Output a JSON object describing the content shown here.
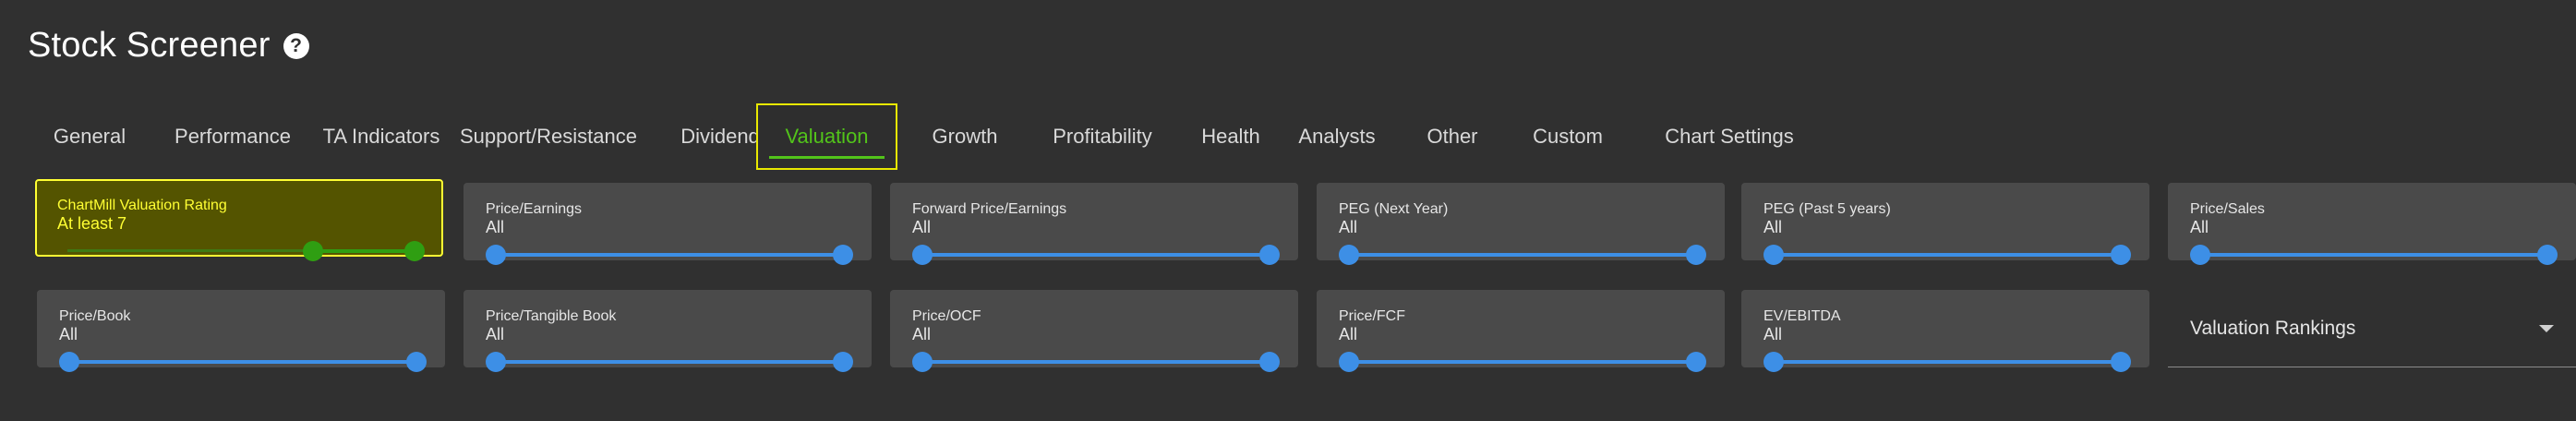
{
  "header": {
    "title": "Stock Screener",
    "help_glyph": "?"
  },
  "tabs": [
    {
      "label": "General"
    },
    {
      "label": "Performance"
    },
    {
      "label": "TA Indicators"
    },
    {
      "label": "Support/Resistance"
    },
    {
      "label": "Dividend"
    },
    {
      "label": "Valuation",
      "active": true
    },
    {
      "label": "Growth"
    },
    {
      "label": "Profitability"
    },
    {
      "label": "Health"
    },
    {
      "label": "Analysts"
    },
    {
      "label": "Other"
    },
    {
      "label": "Custom"
    },
    {
      "label": "Chart Settings"
    }
  ],
  "filters": [
    {
      "label": "ChartMill Valuation Rating",
      "value": "At least 7",
      "selected": true
    },
    {
      "label": "Price/Earnings",
      "value": "All"
    },
    {
      "label": "Forward Price/Earnings",
      "value": "All"
    },
    {
      "label": "PEG (Next Year)",
      "value": "All"
    },
    {
      "label": "PEG (Past 5 years)",
      "value": "All"
    },
    {
      "label": "Price/Sales",
      "value": "All"
    },
    {
      "label": "Price/Book",
      "value": "All"
    },
    {
      "label": "Price/Tangible Book",
      "value": "All"
    },
    {
      "label": "Price/OCF",
      "value": "All"
    },
    {
      "label": "Price/FCF",
      "value": "All"
    },
    {
      "label": "EV/EBITDA",
      "value": "All"
    }
  ],
  "rankings_dropdown": {
    "label": "Valuation Rankings",
    "icon": "chevron-down-icon"
  },
  "colors": {
    "accent_active": "#52c41a",
    "highlight": "#ffff33",
    "slider": "#3d8fe6"
  }
}
